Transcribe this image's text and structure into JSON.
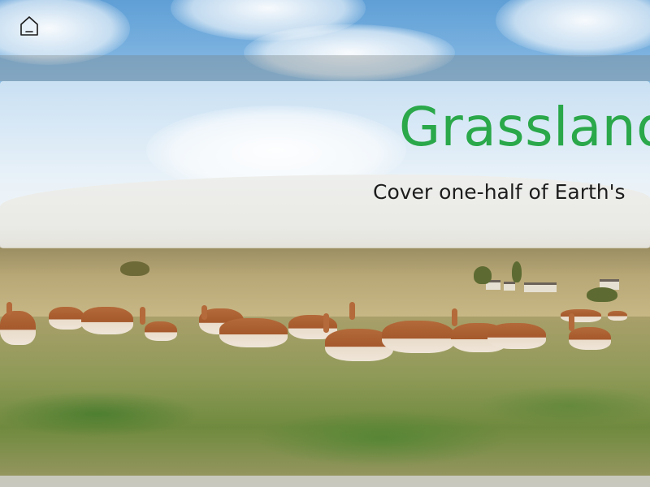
{
  "page": {
    "background_image": "grassland-herd-photo"
  },
  "header": {
    "home_icon": "home-icon"
  },
  "hero": {
    "title": "Grassland",
    "subtitle": "Cover one-half of Earth's",
    "title_color": "#2aa84a",
    "subtitle_color": "#1d1d1d"
  }
}
